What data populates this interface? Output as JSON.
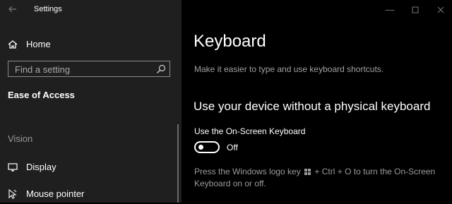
{
  "window": {
    "title": "Settings",
    "controls": [
      "minimize",
      "maximize",
      "close"
    ]
  },
  "sidebar": {
    "home_label": "Home",
    "search_placeholder": "Find a setting",
    "section_title": "Ease of Access",
    "group_title": "Vision",
    "items": [
      {
        "label": "Display",
        "icon": "display-icon"
      },
      {
        "label": "Mouse pointer",
        "icon": "mouse-pointer-icon"
      }
    ]
  },
  "main": {
    "title": "Keyboard",
    "description": "Make it easier to type and use keyboard shortcuts.",
    "section_title": "Use your device without a physical keyboard",
    "toggle": {
      "label": "Use the On-Screen Keyboard",
      "state_text": "Off",
      "value": false
    },
    "hint_before": "Press the Windows logo key",
    "hint_after": "+ Ctrl + O to turn the On-Screen Keyboard on or off."
  },
  "colors": {
    "sidebar_bg": "#1f1f1f",
    "main_bg": "#000000",
    "muted_text": "#9a9a9a"
  }
}
